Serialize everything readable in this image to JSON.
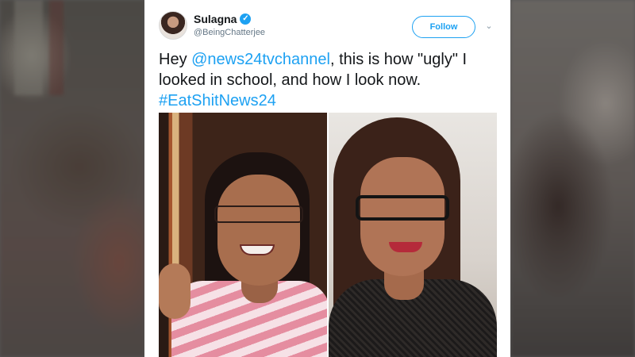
{
  "tweet": {
    "author": {
      "display_name": "Sulagna",
      "handle": "@BeingChatterjee",
      "verified_icon": "verified-badge-icon"
    },
    "follow_label": "Follow",
    "text": {
      "prefix": "Hey ",
      "mention": "@news24tvchannel",
      "body": ", this is how \"ugly\" I looked in school, and how I look now. ",
      "hashtag": "#EatShitNews24"
    },
    "media": {
      "image_count": 2
    }
  },
  "colors": {
    "accent": "#1da1f2",
    "text": "#14171a",
    "secondary_text": "#657786",
    "background": "#ffffff"
  }
}
